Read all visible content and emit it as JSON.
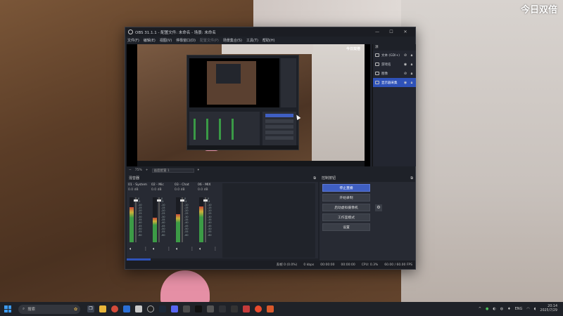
{
  "watermark": "今日双倍",
  "window": {
    "title": "OBS 31.1.1 - 配置文件: 未命名 - 场景: 未命名",
    "controls": [
      "—",
      "☐",
      "✕"
    ]
  },
  "menu": [
    {
      "label": "文件(F)",
      "dim": false
    },
    {
      "label": "编辑(E)",
      "dim": false
    },
    {
      "label": "视图(V)",
      "dim": false
    },
    {
      "label": "停靠窗口(D)",
      "dim": false
    },
    {
      "label": "配置文件(P)",
      "dim": true
    },
    {
      "label": "场景集合(S)",
      "dim": false
    },
    {
      "label": "工具(T)",
      "dim": false
    },
    {
      "label": "帮助(H)",
      "dim": false
    }
  ],
  "preview": {
    "watermark": "今日双倍",
    "zoom": "75%",
    "scene_select": "画面配置 1"
  },
  "sources": {
    "title": "源",
    "items": [
      {
        "name": "文本 (GDI+)",
        "selected": false
      },
      {
        "name": "游戏名",
        "selected": false
      },
      {
        "name": "图像",
        "selected": false
      },
      {
        "name": "显示器采集",
        "selected": true
      }
    ]
  },
  "mixer": {
    "title": "混音器",
    "channels": [
      {
        "name": "01 - System",
        "db": "0.0 dB",
        "level": 0.78,
        "fader": 0.05
      },
      {
        "name": "02 - Mic",
        "db": "0.0 dB",
        "level": 0.55,
        "fader": 0.05
      },
      {
        "name": "03 - Chat",
        "db": "0.0 dB",
        "level": 0.62,
        "fader": 0.05
      },
      {
        "name": "06 - MIX",
        "db": "0.0 dB",
        "level": 0.8,
        "fader": 0.05
      }
    ],
    "ticks": [
      "0",
      "-5",
      "-10",
      "-15",
      "-20",
      "-25",
      "-30",
      "-35",
      "-40",
      "-45",
      "-50",
      "-55",
      "-60"
    ],
    "tabs": [
      {
        "label": "混音器",
        "active": true
      },
      {
        "label": "统计",
        "active": false
      }
    ]
  },
  "controls": {
    "title": "控制按钮",
    "buttons": {
      "stop_stream": "停止直播",
      "start_record": "开始录制",
      "start_vcam": "启动虚拟摄像机",
      "studio_mode": "工作室模式",
      "settings": "设置"
    }
  },
  "status": {
    "dropped": "丢帧 0 (0.0%)",
    "bitrate": "0 kbps",
    "stream_time": "00:00:00",
    "rec_time": "00:00:00",
    "cpu": "CPU: 0.3%",
    "fps": "60.00 / 60.00 FPS"
  },
  "taskbar": {
    "search_placeholder": "搜索",
    "tray_lang": "ENG",
    "time": "20:14",
    "date": "2025/7/29"
  }
}
